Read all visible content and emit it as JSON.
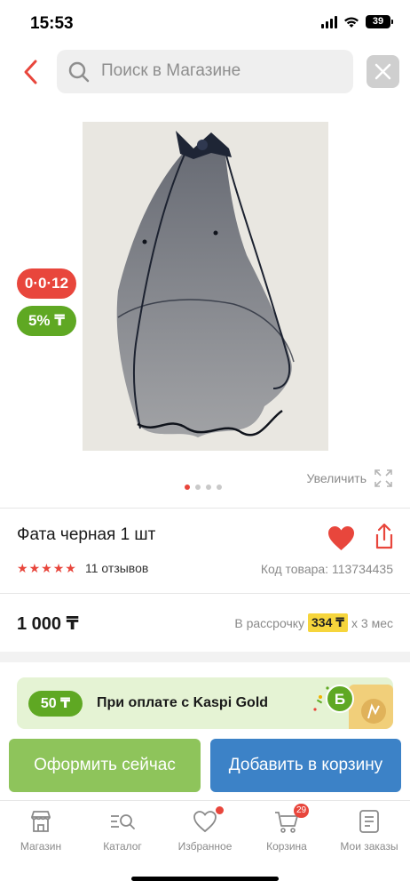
{
  "status_bar": {
    "time": "15:53",
    "battery": "39"
  },
  "search": {
    "placeholder": "Поиск в Магазине"
  },
  "badges": {
    "installment": "0·0·12",
    "bonus": "5% ₸"
  },
  "gallery": {
    "zoom_label": "Увеличить",
    "current_index": 1,
    "total": 4
  },
  "product": {
    "title": "Фата черная 1 шт",
    "rating": 5,
    "reviews": "11 отзывов",
    "code": "Код товара: 113734435",
    "price": "1 000 ₸",
    "installment_prefix": "В рассрочку",
    "installment_amount": "334 ₸",
    "installment_suffix": "x 3 мес"
  },
  "promo": {
    "bonus": "50 ₸",
    "text": "При оплате с Kaspi Gold"
  },
  "actions": {
    "checkout": "Оформить сейчас",
    "add_to_cart": "Добавить в корзину"
  },
  "nav": {
    "items": [
      {
        "label": "Магазин"
      },
      {
        "label": "Каталог"
      },
      {
        "label": "Избранное"
      },
      {
        "label": "Корзина",
        "badge": "29"
      },
      {
        "label": "Мои заказы"
      }
    ]
  },
  "colors": {
    "accent_red": "#e8463c",
    "green": "#5fa823",
    "blue": "#3c82c7",
    "light_green": "#8ec45b"
  }
}
